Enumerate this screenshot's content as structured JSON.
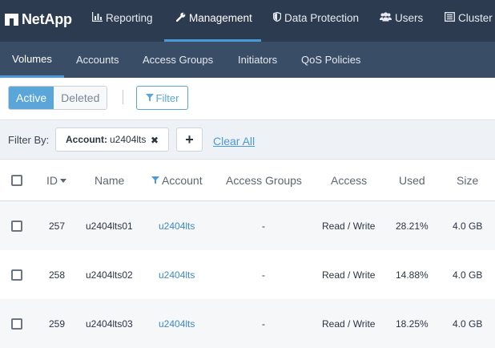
{
  "brand": {
    "logo_text": "NetApp"
  },
  "topnav": {
    "items": [
      {
        "label": "Reporting",
        "icon": "bar-chart-icon"
      },
      {
        "label": "Management",
        "icon": "wrench-icon",
        "active": true
      },
      {
        "label": "Data Protection",
        "icon": "shield-icon"
      },
      {
        "label": "Users",
        "icon": "users-icon"
      },
      {
        "label": "Cluster",
        "icon": "server-icon"
      }
    ]
  },
  "subnav": {
    "items": [
      {
        "label": "Volumes",
        "active": true
      },
      {
        "label": "Accounts"
      },
      {
        "label": "Access Groups"
      },
      {
        "label": "Initiators"
      },
      {
        "label": "QoS Policies"
      }
    ]
  },
  "toolbar": {
    "active_label": "Active",
    "deleted_label": "Deleted",
    "filter_label": "Filter"
  },
  "filterbar": {
    "label": "Filter By:",
    "chip_key": "Account:",
    "chip_value": "u2404lts",
    "clear_all": "Clear All"
  },
  "table": {
    "columns": [
      "ID",
      "Name",
      "Account",
      "Access Groups",
      "Access",
      "Used",
      "Size"
    ],
    "rows": [
      {
        "id": "257",
        "name": "u2404lts01",
        "account": "u2404lts",
        "access_groups": "-",
        "access": "Read / Write",
        "used": "28.21%",
        "size": "4.0 GB"
      },
      {
        "id": "258",
        "name": "u2404lts02",
        "account": "u2404lts",
        "access_groups": "-",
        "access": "Read / Write",
        "used": "14.88%",
        "size": "4.0 GB"
      },
      {
        "id": "259",
        "name": "u2404lts03",
        "account": "u2404lts",
        "access_groups": "-",
        "access": "Read / Write",
        "used": "18.25%",
        "size": "4.0 GB"
      }
    ]
  },
  "colors": {
    "topnav_bg": "#2d3b50",
    "subnav_bg": "#3a4d66",
    "accent": "#4a9ad8",
    "link": "#3d88c5"
  }
}
